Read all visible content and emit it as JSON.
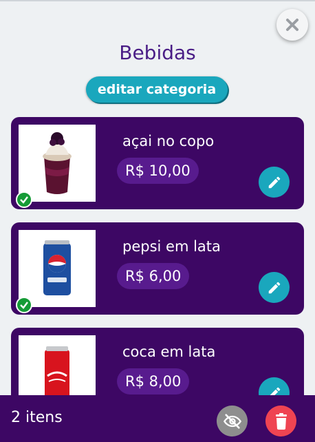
{
  "header": {
    "title": "Bebidas",
    "edit_category_label": "editar categoria",
    "close_icon": "close-icon"
  },
  "products": [
    {
      "name": "açai no copo",
      "price": "R$ 10,00",
      "image": "acai-cup-image",
      "available": true
    },
    {
      "name": "pepsi em lata",
      "price": "R$ 6,00",
      "image": "pepsi-can-image",
      "available": true
    },
    {
      "name": "coca em lata",
      "price": "R$ 8,00",
      "image": "coca-can-image",
      "available": false
    }
  ],
  "footer": {
    "count_label": "2 itens",
    "hide_icon": "eye-off-icon",
    "delete_icon": "trash-icon"
  },
  "colors": {
    "brand_purple": "#3d0764",
    "price_pill": "#581b8e",
    "accent_teal": "#1aa7bd",
    "success_green": "#159b36",
    "danger_red": "#ef4452",
    "muted_gray": "#8e8e8e"
  }
}
